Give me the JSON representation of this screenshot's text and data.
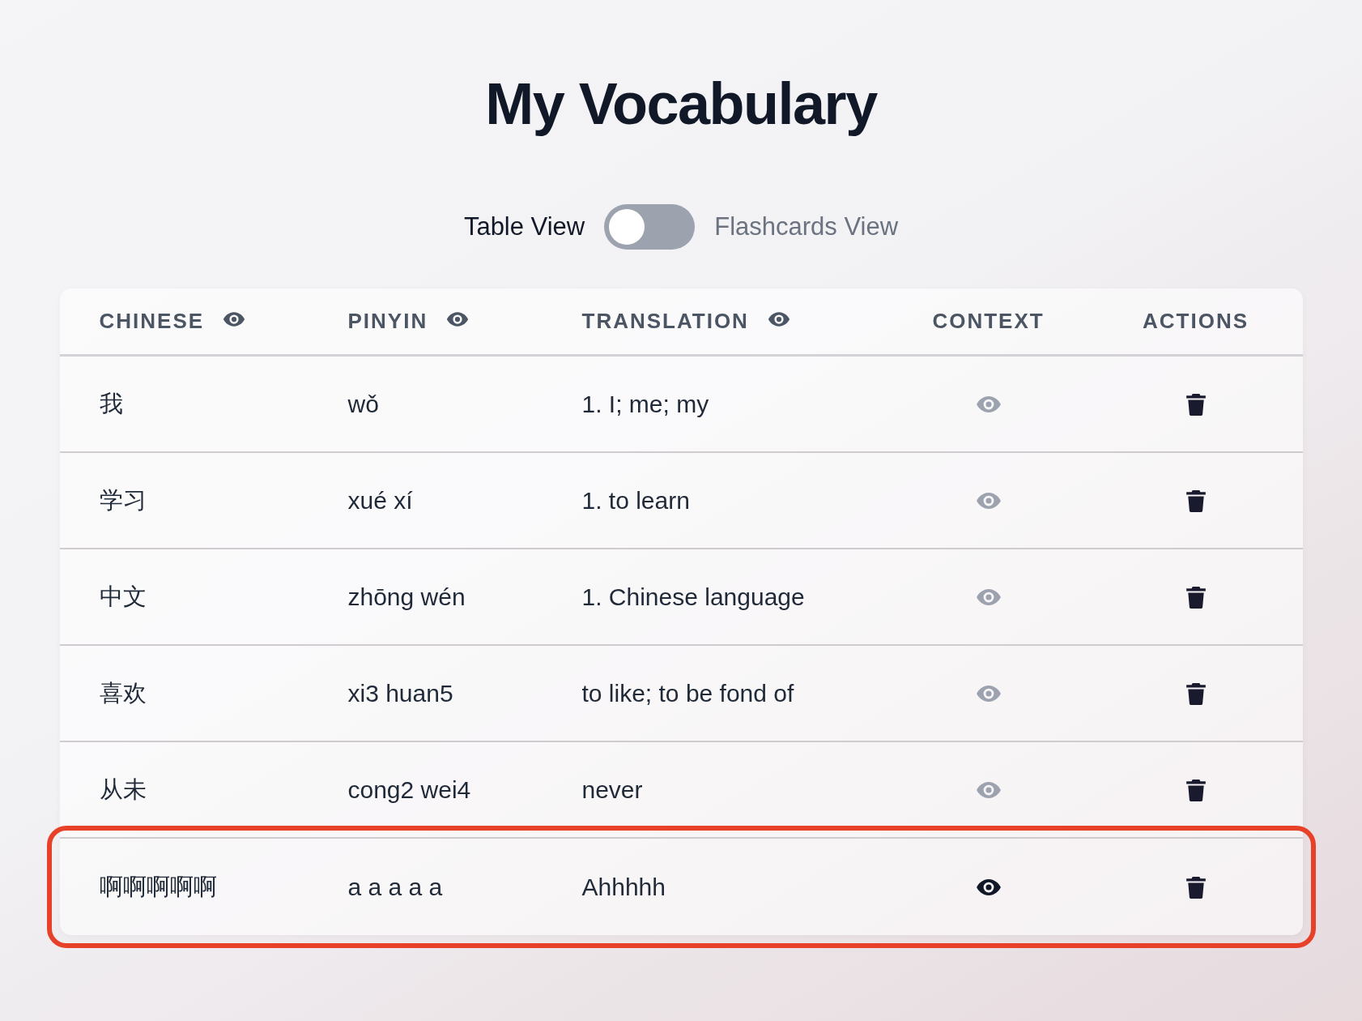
{
  "title": "My Vocabulary",
  "view_toggle": {
    "left_label": "Table View",
    "right_label": "Flashcards View",
    "on": false
  },
  "table": {
    "columns": [
      {
        "label": "CHINESE",
        "kind": "toggleable"
      },
      {
        "label": "PINYIN",
        "kind": "toggleable"
      },
      {
        "label": "TRANSLATION",
        "kind": "toggleable"
      },
      {
        "label": "CONTEXT",
        "kind": "plain"
      },
      {
        "label": "ACTIONS",
        "kind": "plain"
      }
    ],
    "rows": [
      {
        "chinese": "我",
        "pinyin": "wǒ",
        "translation": "1. I; me; my",
        "has_context": false,
        "highlighted": false
      },
      {
        "chinese": "学习",
        "pinyin": "xué xí",
        "translation": "1. to learn",
        "has_context": false,
        "highlighted": false
      },
      {
        "chinese": "中文",
        "pinyin": "zhōng wén",
        "translation": "1. Chinese language",
        "has_context": false,
        "highlighted": false
      },
      {
        "chinese": "喜欢",
        "pinyin": "xi3 huan5",
        "translation": "to like; to be fond of",
        "has_context": false,
        "highlighted": false
      },
      {
        "chinese": "从未",
        "pinyin": "cong2 wei4",
        "translation": "never",
        "has_context": false,
        "highlighted": false
      },
      {
        "chinese": "啊啊啊啊啊",
        "pinyin": "a a a a a",
        "translation": "Ahhhhh",
        "has_context": true,
        "highlighted": true
      }
    ]
  }
}
